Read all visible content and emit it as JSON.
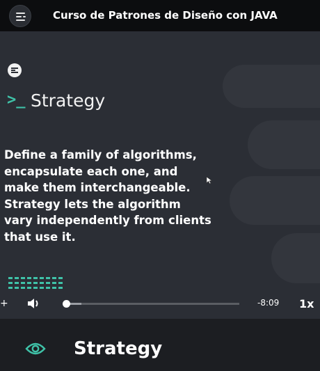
{
  "header": {
    "title": "Curso de Patrones de Diseño con JAVA",
    "logo_icon": "list-menu-icon"
  },
  "slide": {
    "badge_icon": "list-menu-icon",
    "prompt": ">_",
    "heading": "Strategy",
    "description": "Define a family of algorithms, encapsulate each one, and make them interchangeable. Strategy lets the algorithm vary independently from clients that use it.",
    "accent_color": "#3fc2a8"
  },
  "player": {
    "progress": 0.01,
    "buffered": 0.1,
    "time_remaining": "-8:09",
    "speed": "1x"
  },
  "lesson": {
    "title": "Strategy",
    "icon": "eye-icon"
  }
}
